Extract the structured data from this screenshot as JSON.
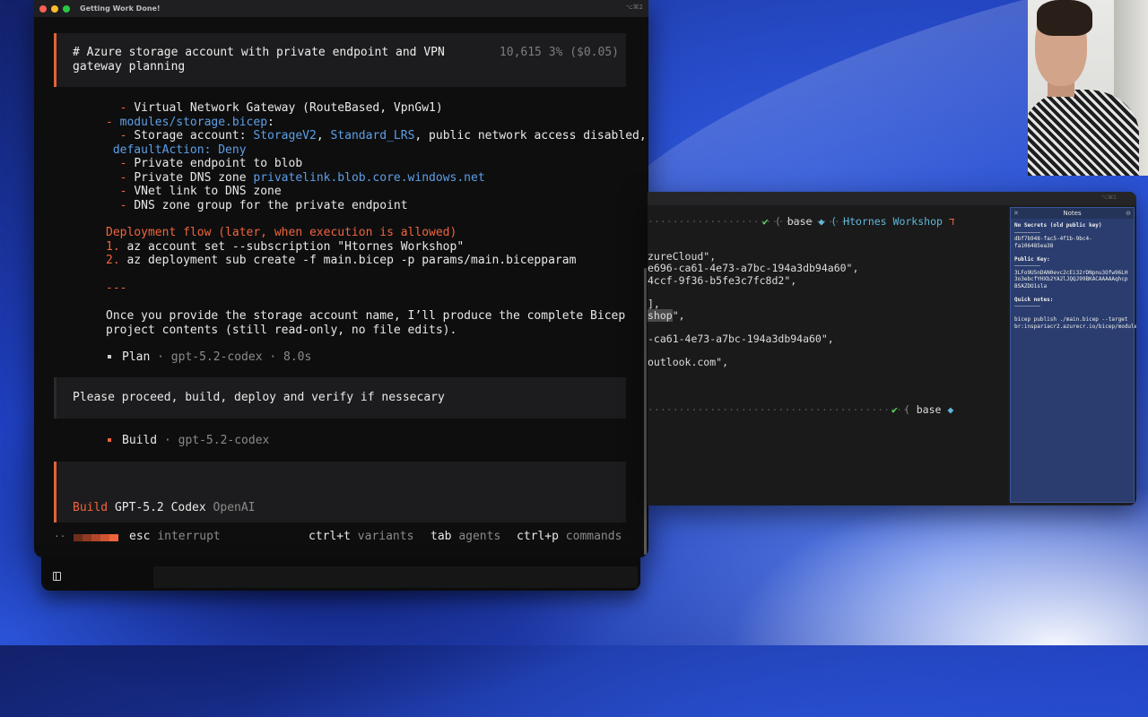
{
  "window": {
    "title": "Getting Work Done!",
    "shortcut": "⌥⌘2"
  },
  "session": {
    "heading": "# Azure storage account with private endpoint and VPN gateway planning",
    "tokens": "10,615",
    "usage": "3% ($0.05)"
  },
  "transcript": {
    "lines": [
      "  - Virtual Network Gateway (RouteBased, VpnGw1)",
      "- modules/storage.bicep:",
      "  - Storage account: StorageV2, Standard_LRS, public network access disabled,",
      " defaultAction: Deny",
      "  - Private endpoint to blob",
      "  - Private DNS zone privatelink.blob.core.windows.net",
      "  - VNet link to DNS zone",
      "  - DNS zone group for the private endpoint"
    ],
    "deploy_title": "Deployment flow (later, when execution is allowed)",
    "deploy_1_num": "1.",
    "deploy_1": "az account set --subscription \"Htornes Workshop\"",
    "deploy_2_num": "2.",
    "deploy_2": "az deployment sub create -f main.bicep -p params/main.bicepparam",
    "separator": "---",
    "closing_1": "Once you provide the storage account name, I’ll produce the complete Bicep",
    "closing_2": "project contents (still read-only, no file edits).",
    "plan_label": "Plan",
    "plan_meta": " · gpt-5.2-codex · 8.0s",
    "user_message": "Please proceed, build, deploy and verify if nessecary",
    "build_label": "Build",
    "build_meta": " · gpt-5.2-codex"
  },
  "input": {
    "mode": "Build",
    "model": "GPT-5.2 Codex",
    "provider": "OpenAI"
  },
  "footer": {
    "esc_key": "esc",
    "esc_action": "interrupt",
    "variants_key": "ctrl+t",
    "variants_action": "variants",
    "agents_key": "tab",
    "agents_action": "agents",
    "commands_key": "ctrl+p",
    "commands_action": "commands",
    "dots": "··"
  },
  "second_terminal": {
    "shortcut": "⌥⌘1",
    "prompt_check": "✔",
    "prompt_env": "base",
    "prompt_sub": "Htornes Workshop",
    "prompt_tail": "ﬢ",
    "out": [
      "zureCloud\",",
      "e696-ca61-4e73-a7bc-194a3db94a60\",",
      "4ccf-9f36-b5fe3c7fc8d2\",",
      "],",
      "shop",
      "\",",
      "-ca61-4e73-a7bc-194a3db94a60\",",
      "outlook.com\","
    ],
    "prompt2_env": "base"
  },
  "notes": {
    "title": "Notes",
    "no_secrets": "No Secrets (old public key)",
    "rule1": "————————",
    "key_id": "dbf7b948-fac5-4f1b-9bc4-fa106485ea38",
    "public_key_label": "Public Key:",
    "rule2": "————————",
    "public_key": "3LFo9U5nDAN0evc2cEi32rDNpnu3Ofw96LH3o3ebcfYHXb2YA2lJQQJ99BKACAAAAAqhcpBSAZDO1sla",
    "quick_label": "Quick notes:",
    "rule3": "————————",
    "quick_note": "bicep publish ./main.bicep --target br:inspariacr2.azurecr.io/bicep/modules/dropbox:v1"
  },
  "colors": {
    "accent": "#f0643c",
    "link": "#5d9fe6",
    "terminal_bg": "#0e0e0f",
    "notes_bg": "#2a3d6e"
  }
}
